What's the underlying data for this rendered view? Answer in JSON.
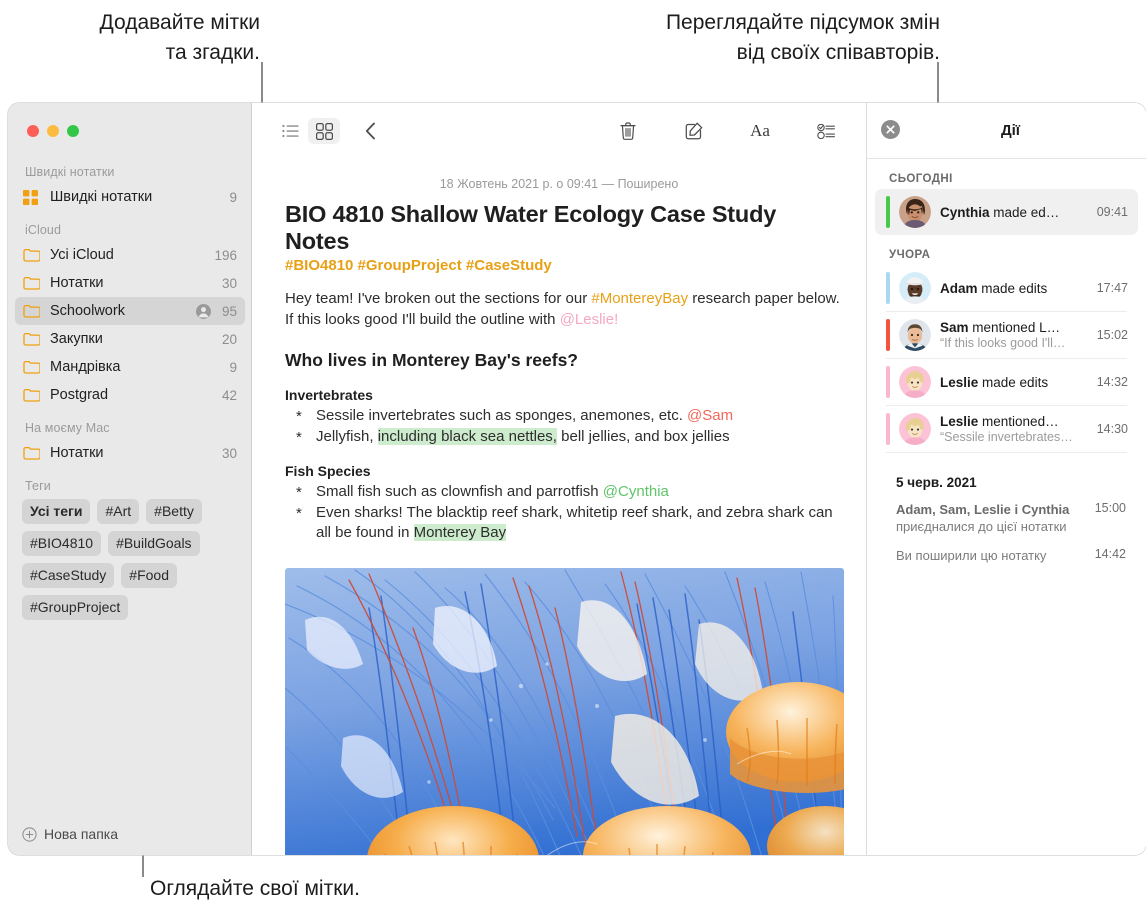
{
  "callouts": [
    {
      "id": "tags-mentions",
      "text": "Додавайте мітки\nта згадки."
    },
    {
      "id": "collab-summary",
      "text": "Переглядайте підсумок змін\nвід своїх співавторів."
    },
    {
      "id": "browse-tags",
      "text": "Оглядайте свої мітки."
    }
  ],
  "window": {
    "traffic_lights": [
      "close-red",
      "minimize-yellow",
      "zoom-green"
    ]
  },
  "sidebar": {
    "sections": [
      {
        "title": "Швидкі нотатки",
        "rows": [
          {
            "icon": "quick-notes-icon",
            "label": "Швидкі нотатки",
            "count": "9",
            "selected": false,
            "shared": false
          }
        ]
      },
      {
        "title": "iCloud",
        "rows": [
          {
            "icon": "folder-icon",
            "label": "Усі iCloud",
            "count": "196",
            "selected": false,
            "shared": false
          },
          {
            "icon": "folder-icon",
            "label": "Нотатки",
            "count": "30",
            "selected": false,
            "shared": false
          },
          {
            "icon": "folder-icon",
            "label": "Schoolwork",
            "count": "95",
            "selected": true,
            "shared": true
          },
          {
            "icon": "folder-icon",
            "label": "Закупки",
            "count": "20",
            "selected": false,
            "shared": false
          },
          {
            "icon": "folder-icon",
            "label": "Мандрівка",
            "count": "9",
            "selected": false,
            "shared": false
          },
          {
            "icon": "folder-icon",
            "label": "Postgrad",
            "count": "42",
            "selected": false,
            "shared": false
          }
        ]
      },
      {
        "title": "На моєму Mac",
        "rows": [
          {
            "icon": "folder-icon",
            "label": "Нотатки",
            "count": "30",
            "selected": false,
            "shared": false
          }
        ]
      }
    ],
    "tags_title": "Теги",
    "tags": [
      {
        "label": "Усі теги",
        "all": true
      },
      {
        "label": "#Art",
        "all": false
      },
      {
        "label": "#Betty",
        "all": false
      },
      {
        "label": "#BIO4810",
        "all": false
      },
      {
        "label": "#BuildGoals",
        "all": false
      },
      {
        "label": "#CaseStudy",
        "all": false
      },
      {
        "label": "#Food",
        "all": false
      },
      {
        "label": "#GroupProject",
        "all": false
      }
    ],
    "new_folder_label": "Нова папка"
  },
  "toolbar": {
    "left": [
      {
        "name": "list-view-icon",
        "active": false
      },
      {
        "name": "gallery-view-icon",
        "active": true
      },
      {
        "name": "back-chevron-icon",
        "active": false
      }
    ],
    "center": [
      {
        "name": "trash-icon"
      },
      {
        "name": "compose-icon"
      },
      {
        "name": "format-aa-icon"
      },
      {
        "name": "checklist-icon"
      },
      {
        "name": "table-icon"
      },
      {
        "name": "add-link-icon"
      },
      {
        "name": "lock-icon"
      }
    ],
    "right": [
      {
        "name": "media-icon"
      },
      {
        "name": "collaborate-icon"
      },
      {
        "name": "share-icon"
      },
      {
        "name": "search-icon"
      }
    ]
  },
  "note": {
    "date": "18 Жовтень 2021 р. о 09:41 — Поширено",
    "title": "BIO 4810 Shallow Water Ecology Case Study Notes",
    "tags_line": "#BIO4810 #GroupProject #CaseStudy",
    "intro": {
      "part1": "Hey team! I've broken out the sections for our ",
      "tag": "#MontereyBay",
      "part2": " research paper below. If this looks good I'll build the outline with ",
      "mention": "@Leslie!"
    },
    "heading": "Who lives in Monterey Bay's reefs?",
    "sections": [
      {
        "subheading": "Invertebrates",
        "items": [
          {
            "pre": "Sessile invertebrates such as sponges, anemones, etc. ",
            "mention": "@Sam",
            "mention_color": "red",
            "post": ""
          },
          {
            "pre": "Jellyfish, ",
            "highlight": "including black sea nettles,",
            "post": " bell jellies, and box jellies"
          }
        ]
      },
      {
        "subheading": "Fish Species",
        "items": [
          {
            "pre": "Small fish such as clownfish and parrotfish ",
            "mention": "@Cynthia",
            "mention_color": "green",
            "post": ""
          },
          {
            "pre": "Even sharks! The blacktip reef shark, whitetip reef shark, and zebra shark can all be found in ",
            "highlight": "Monterey Bay",
            "post": ""
          }
        ]
      }
    ],
    "image_alt": "jellyfish-photo"
  },
  "activity": {
    "close_label": "close-activity",
    "title": "Дії",
    "groups": [
      {
        "label": "СЬОГОДНІ",
        "rows": [
          {
            "person": "Cynthia",
            "action": " made ed…",
            "quote": "",
            "time": "09:41",
            "bar_color": "#48c94a",
            "avatar_bg": "#d9b9a6",
            "selected": true,
            "avatar": "avatar-cynthia"
          }
        ]
      },
      {
        "label": "УЧОРА",
        "rows": [
          {
            "person": "Adam",
            "action": " made edits",
            "quote": "",
            "time": "17:47",
            "bar_color": "#a9d8f0",
            "avatar_bg": "#d3ecf9",
            "selected": false,
            "avatar": "avatar-adam"
          },
          {
            "person": "Sam",
            "action": " mentioned L…",
            "quote": "“If this looks good I'll…",
            "time": "15:02",
            "bar_color": "#f2543d",
            "avatar_bg": "#dfe4e8",
            "selected": false,
            "avatar": "avatar-sam"
          },
          {
            "person": "Leslie",
            "action": " made edits",
            "quote": "",
            "time": "14:32",
            "bar_color": "#fbb7cb",
            "avatar_bg": "#fbc3d6",
            "selected": false,
            "avatar": "avatar-leslie"
          },
          {
            "person": "Leslie",
            "action": " mentioned…",
            "quote": "“Sessile invertebrates…",
            "time": "14:30",
            "bar_color": "#fbb7cb",
            "avatar_bg": "#fbc3d6",
            "selected": false,
            "avatar": "avatar-leslie"
          }
        ]
      }
    ],
    "older": {
      "date": "5 черв. 2021",
      "entries": [
        {
          "bold": "Adam, Sam, Leslie і Cynthia",
          "rest": "приєдналися до цієї нотатки",
          "time": "15:00"
        },
        {
          "bold": "",
          "rest": "Ви поширили цю нотатку",
          "time": "14:42"
        }
      ]
    }
  },
  "colors": {
    "accent_yellow": "#e8a015",
    "highlight_green": "#cdebcd",
    "mention_red": "#f2675a",
    "mention_green": "#5fc46a",
    "mention_pink": "#f5a8c0",
    "sidebar_bg": "#e9e9e9",
    "selected_row": "#d6d5d5"
  }
}
